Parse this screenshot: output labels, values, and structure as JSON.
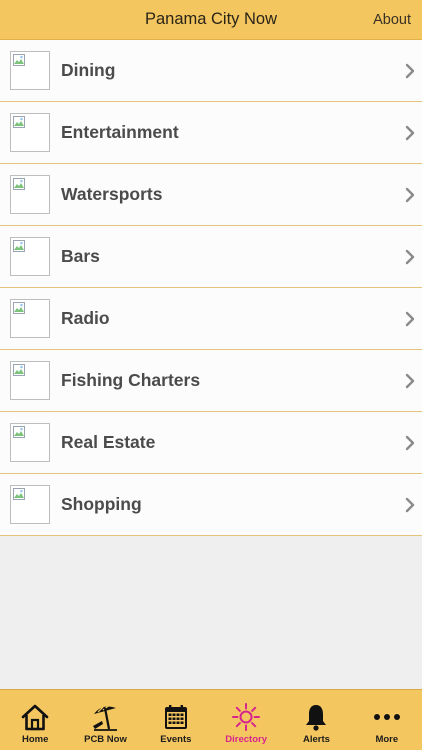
{
  "header": {
    "title": "Panama City Now",
    "about_label": "About"
  },
  "directory": {
    "items": [
      {
        "label": "Dining"
      },
      {
        "label": "Entertainment"
      },
      {
        "label": "Watersports"
      },
      {
        "label": "Bars"
      },
      {
        "label": "Radio"
      },
      {
        "label": "Fishing Charters"
      },
      {
        "label": "Real Estate"
      },
      {
        "label": "Shopping"
      }
    ]
  },
  "tabbar": {
    "active_tab": "Directory",
    "active_color": "#d8248f",
    "tabs": [
      {
        "label": "Home",
        "icon": "home-icon"
      },
      {
        "label": "PCB Now",
        "icon": "beach-umbrella-icon"
      },
      {
        "label": "Events",
        "icon": "calendar-icon"
      },
      {
        "label": "Directory",
        "icon": "sun-icon"
      },
      {
        "label": "Alerts",
        "icon": "bell-icon"
      },
      {
        "label": "More",
        "icon": "more-dots-icon"
      }
    ]
  },
  "colors": {
    "bar_background": "#f3c65f",
    "row_divider": "#e7c47b",
    "row_text": "#4b4b4b",
    "empty_background": "#efefef"
  }
}
